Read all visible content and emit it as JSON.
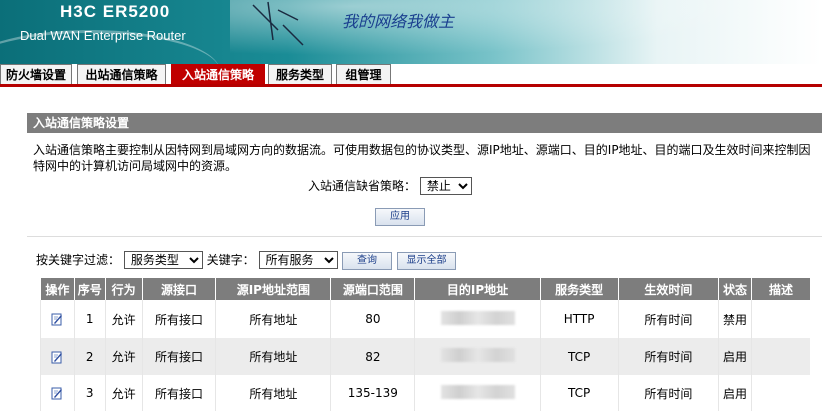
{
  "header": {
    "brand": "H3C ER5200",
    "subtitle": "Dual WAN Enterprise Router",
    "slogan": "我的网络我做主",
    "colors": {
      "teal": "#0b6f79",
      "accent_red": "#c00000"
    }
  },
  "tabs": [
    {
      "label": "防火墙设置",
      "active": false
    },
    {
      "label": "出站通信策略",
      "active": false
    },
    {
      "label": "入站通信策略",
      "active": true
    },
    {
      "label": "服务类型",
      "active": false
    },
    {
      "label": "组管理",
      "active": false
    }
  ],
  "section": {
    "title": "入站通信策略设置",
    "description": "入站通信策略主要控制从因特网到局域网方向的数据流。可使用数据包的协议类型、源IP地址、源端口、目的IP地址、目的端口及生效时间来控制因特网中的计算机访问局域网中的资源。"
  },
  "default_policy": {
    "label": "入站通信缺省策略：",
    "value": "禁止"
  },
  "apply_button": "应用",
  "filter": {
    "label": "按关键字过滤：",
    "field_value": "服务类型",
    "keyword_label": "关键字：",
    "keyword_value": "所有服务",
    "query_button": "查询",
    "show_all_button": "显示全部"
  },
  "table": {
    "headers": [
      "操作",
      "序号",
      "行为",
      "源接口",
      "源IP地址范围",
      "源端口范围",
      "目的IP地址",
      "服务类型",
      "生效时间",
      "状态",
      "描述"
    ],
    "rows": [
      {
        "no": "1",
        "action": "允许",
        "src_if": "所有接口",
        "src_ip": "所有地址",
        "src_port": "80",
        "service": "HTTP",
        "time": "所有时间",
        "status": "禁用",
        "desc": ""
      },
      {
        "no": "2",
        "action": "允许",
        "src_if": "所有接口",
        "src_ip": "所有地址",
        "src_port": "82",
        "service": "TCP",
        "time": "所有时间",
        "status": "启用",
        "desc": ""
      },
      {
        "no": "3",
        "action": "允许",
        "src_if": "所有接口",
        "src_ip": "所有地址",
        "src_port": "135-139",
        "service": "TCP",
        "time": "所有时间",
        "status": "启用",
        "desc": ""
      }
    ]
  }
}
